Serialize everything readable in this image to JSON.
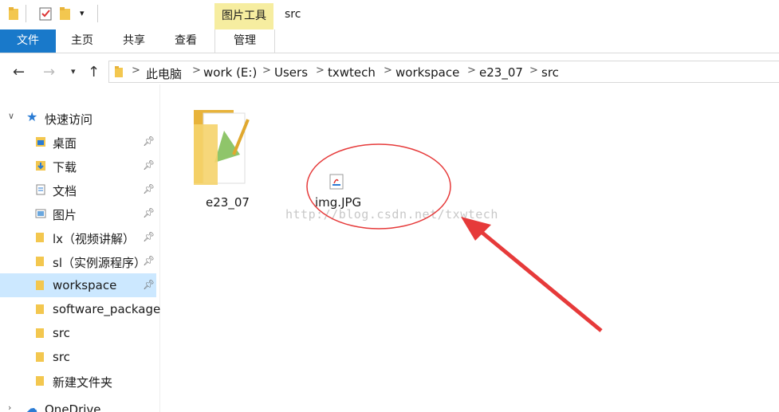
{
  "window": {
    "title": "src"
  },
  "ribbon": {
    "context_group": "图片工具",
    "tabs": {
      "file": "文件",
      "home": "主页",
      "share": "共享",
      "view": "查看",
      "manage": "管理"
    }
  },
  "address": {
    "segments": [
      "此电脑",
      "work (E:)",
      "Users",
      "txwtech",
      "workspace",
      "e23_07",
      "src"
    ]
  },
  "sidebar": {
    "quick_access": "快速访问",
    "items": [
      {
        "label": "桌面",
        "pinned": true
      },
      {
        "label": "下载",
        "pinned": true
      },
      {
        "label": "文档",
        "pinned": true
      },
      {
        "label": "图片",
        "pinned": true
      },
      {
        "label": "lx（视频讲解）",
        "pinned": true
      },
      {
        "label": "sl（实例源程序）",
        "pinned": true
      },
      {
        "label": "workspace",
        "pinned": true,
        "selected": true
      },
      {
        "label": "software_package",
        "pinned": false
      },
      {
        "label": "src",
        "pinned": false
      },
      {
        "label": "src",
        "pinned": false
      },
      {
        "label": "新建文件夹",
        "pinned": false
      }
    ],
    "onedrive": "OneDrive"
  },
  "files": [
    {
      "name": "e23_07",
      "type": "folder"
    },
    {
      "name": "img.JPG",
      "type": "java-file"
    }
  ],
  "watermark": "http://blog.csdn.net/txwtech",
  "colors": {
    "file_tab": "#1979ca",
    "context_tab": "#f6eda0",
    "selection": "#cce8ff",
    "annotation": "#e63a3a"
  }
}
